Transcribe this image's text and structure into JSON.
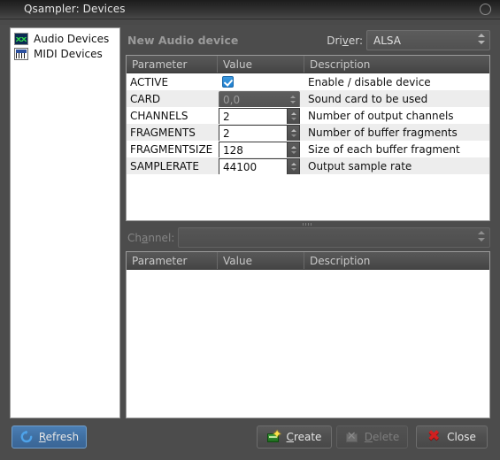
{
  "window": {
    "title": "Qsampler: Devices",
    "close_icon": "circle-close-icon"
  },
  "sidebar": {
    "items": [
      {
        "label": "Audio Devices",
        "icon": "audio-device-icon",
        "selected": false
      },
      {
        "label": "MIDI Devices",
        "icon": "midi-device-icon",
        "selected": false
      }
    ]
  },
  "device_panel": {
    "title": "New Audio device",
    "driver": {
      "label_pre": "Dri",
      "label_accel": "v",
      "label_post": "er:",
      "value": "ALSA"
    },
    "table": {
      "columns": [
        "Parameter",
        "Value",
        "Description"
      ],
      "rows": [
        {
          "parameter": "ACTIVE",
          "value": "",
          "value_type": "checkbox",
          "checked": true,
          "description": "Enable / disable device"
        },
        {
          "parameter": "CARD",
          "value": "0,0",
          "value_type": "combo-disabled",
          "description": "Sound card to be used"
        },
        {
          "parameter": "CHANNELS",
          "value": "2",
          "value_type": "spinbox",
          "description": "Number of output channels"
        },
        {
          "parameter": "FRAGMENTS",
          "value": "2",
          "value_type": "spinbox",
          "description": "Number of buffer fragments"
        },
        {
          "parameter": "FRAGMENTSIZE",
          "value": "128",
          "value_type": "spinbox",
          "description": "Size of each buffer fragment"
        },
        {
          "parameter": "SAMPLERATE",
          "value": "44100",
          "value_type": "spinbox",
          "description": "Output sample rate"
        }
      ]
    }
  },
  "channel_panel": {
    "label_pre": "Ch",
    "label_accel": "a",
    "label_post": "nnel:",
    "value": "",
    "table": {
      "columns": [
        "Parameter",
        "Value",
        "Description"
      ],
      "rows": []
    }
  },
  "buttons": {
    "refresh": {
      "pre": "",
      "accel": "R",
      "post": "efresh",
      "icon": "refresh-icon",
      "state": "focused"
    },
    "create": {
      "pre": "",
      "accel": "C",
      "post": "reate",
      "icon": "create-device-icon",
      "state": "enabled"
    },
    "delete": {
      "pre": "",
      "accel": "D",
      "post": "elete",
      "icon": "delete-device-icon",
      "state": "disabled"
    },
    "close": {
      "pre": "",
      "accel": "",
      "post": "Close",
      "icon": "close-x-icon",
      "state": "enabled"
    }
  },
  "colors": {
    "window_bg": "#4c4c4c",
    "panel_bg": "#ffffff",
    "accent_focus": "#3f6ea0",
    "checkbox": "#1e7fd0",
    "close_x": "#d02020",
    "create_green": "#3fa03f"
  }
}
